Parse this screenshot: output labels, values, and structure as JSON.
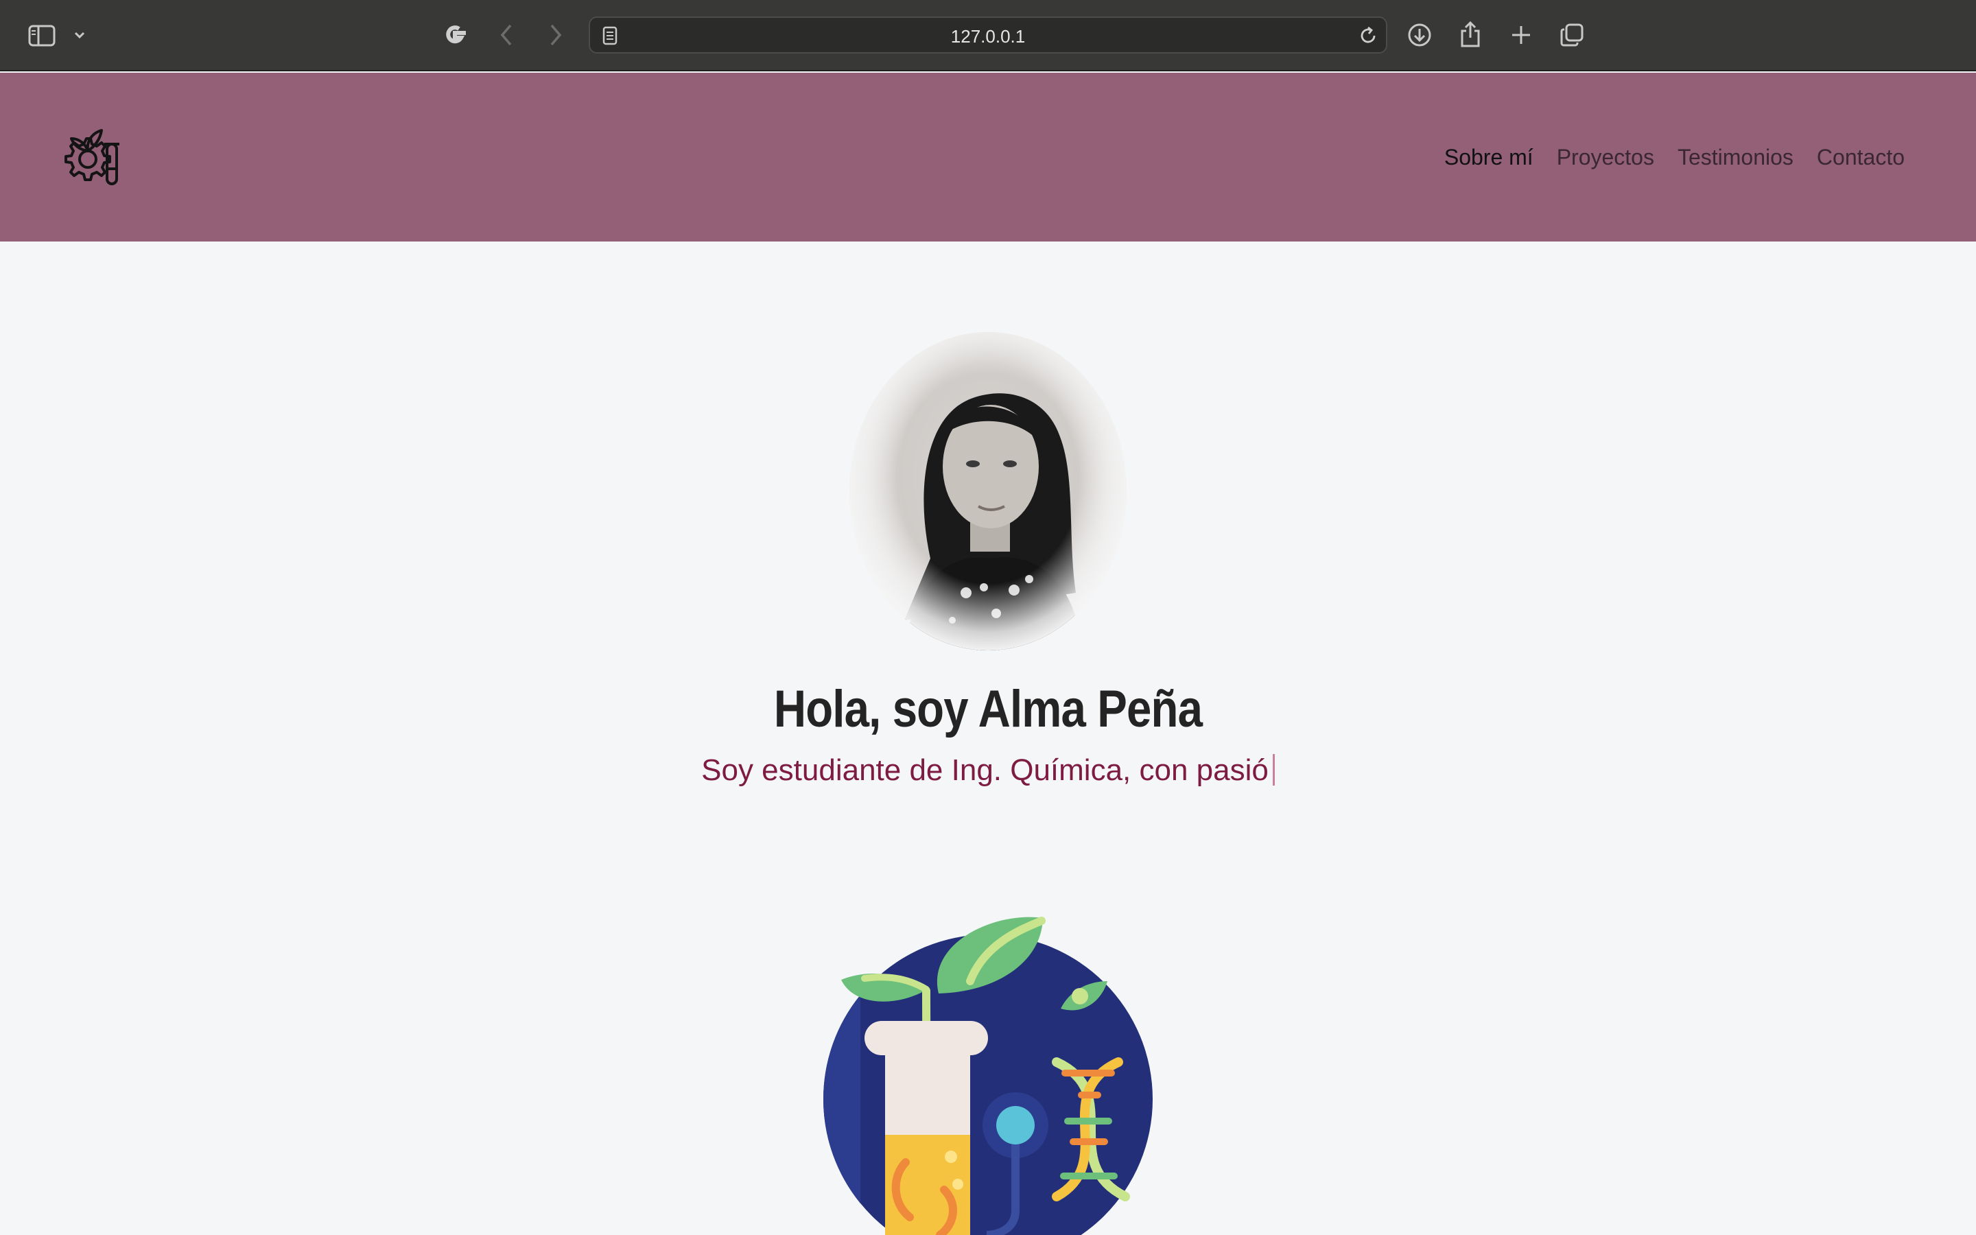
{
  "browser": {
    "url": "127.0.0.1",
    "icons": [
      "sidebar-icon",
      "chevron-down-icon",
      "google-icon",
      "back-icon",
      "forward-icon",
      "reader-icon",
      "reload-icon",
      "download-icon",
      "share-icon",
      "new-tab-icon",
      "tabs-overview-icon"
    ]
  },
  "header": {
    "logo_icon": "gear-flask-plant-icon",
    "nav": {
      "about": "Sobre mí",
      "projects": "Proyectos",
      "testimonials": "Testimonios",
      "contact": "Contacto"
    }
  },
  "hero": {
    "title": "Hola, soy Alma Peña",
    "subtitle": "Soy estudiante de Ing. Química, con pasió"
  },
  "colors": {
    "header_bg": "#936078",
    "subtitle": "#7d1b40",
    "page_bg": "#f5f6f8"
  }
}
